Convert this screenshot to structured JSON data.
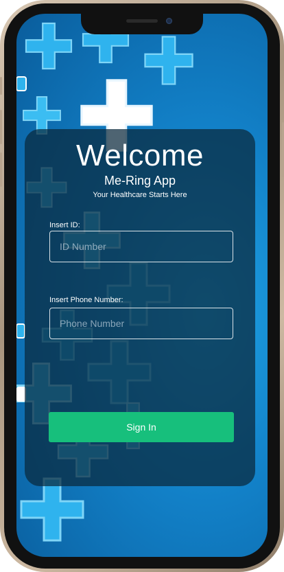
{
  "app": {
    "welcome_title": "Welcome",
    "app_name": "Me-Ring App",
    "tagline": "Your Healthcare Starts Here"
  },
  "form": {
    "id_label": "Insert ID:",
    "id_placeholder": "ID Number",
    "phone_label": "Insert Phone Number:",
    "phone_placeholder": "Phone Number",
    "sign_in_label": "Sign In"
  },
  "colors": {
    "background": "#1280c7",
    "card_overlay": "#0a283c",
    "sign_in_button": "#17bf7c",
    "cross_light": "#2fb3ee",
    "cross_white": "#ffffff"
  },
  "icons": [
    "medical-cross-icon",
    "camera-icon",
    "speaker-icon"
  ]
}
